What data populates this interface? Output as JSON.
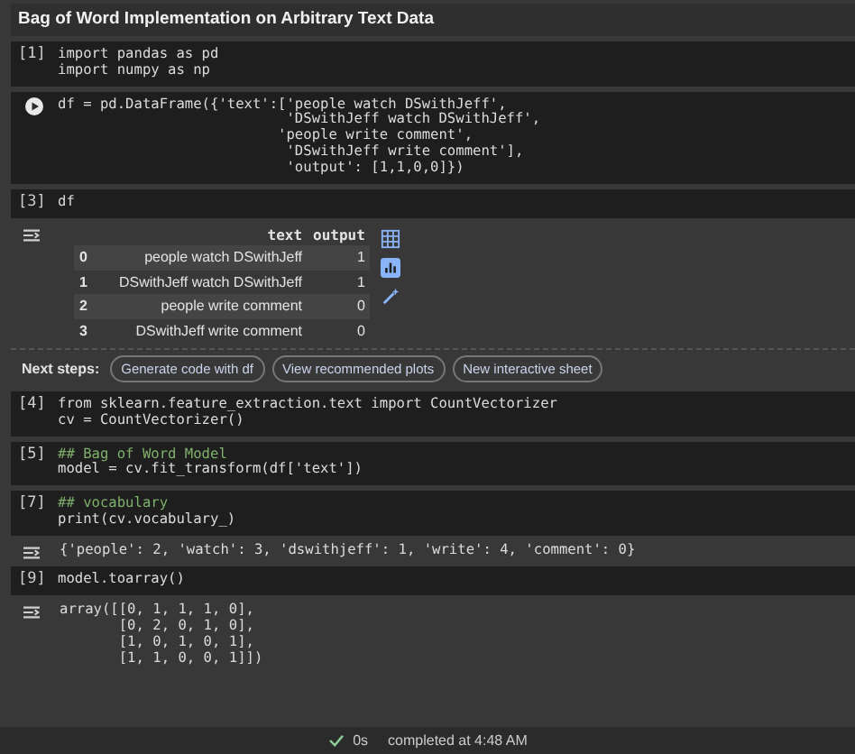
{
  "title": "Bag of Word Implementation on Arbitrary Text Data",
  "cells": [
    {
      "prompt": "[1]",
      "run_button": false,
      "lines": [
        {
          "text": "import pandas as pd",
          "comment": false
        },
        {
          "text": "import numpy as np",
          "comment": false
        }
      ]
    },
    {
      "run_button": true,
      "lines": [
        {
          "text": "df = pd.DataFrame({'text':['people watch DSwithJeff',",
          "comment": false
        },
        {
          "text": "                           'DSwithJeff watch DSwithJeff',",
          "comment": false
        },
        {
          "text": "                          'people write comment',",
          "comment": false
        },
        {
          "text": "                           'DSwithJeff write comment'],",
          "comment": false
        },
        {
          "text": "                           'output': [1,1,0,0]})",
          "comment": false
        }
      ]
    },
    {
      "prompt": "[3]",
      "run_button": false,
      "lines": [
        {
          "text": "df",
          "comment": false
        }
      ],
      "output": {
        "kind": "table",
        "columns": [
          "",
          "text",
          "output"
        ],
        "rows": [
          [
            "0",
            "people watch DSwithJeff",
            "1"
          ],
          [
            "1",
            "DSwithJeff watch DSwithJeff",
            "1"
          ],
          [
            "2",
            "people write comment",
            "0"
          ],
          [
            "3",
            "DSwithJeff write comment",
            "0"
          ]
        ],
        "next_steps": {
          "label": "Next steps:",
          "buttons": [
            "Generate code with df",
            "View recommended plots",
            "New interactive sheet"
          ]
        }
      }
    },
    {
      "prompt": "[4]",
      "run_button": false,
      "lines": [
        {
          "text": "from sklearn.feature_extraction.text import CountVectorizer",
          "comment": false
        },
        {
          "text": "cv = CountVectorizer()",
          "comment": false
        }
      ]
    },
    {
      "prompt": "[5]",
      "run_button": false,
      "lines": [
        {
          "text": "## Bag of Word Model",
          "comment": true
        },
        {
          "text": "model = cv.fit_transform(df['text'])",
          "comment": false
        }
      ]
    },
    {
      "prompt": "[7]",
      "run_button": false,
      "lines": [
        {
          "text": "## vocabulary",
          "comment": true
        },
        {
          "text": "print(cv.vocabulary_)",
          "comment": false
        }
      ],
      "output": {
        "kind": "text",
        "lines": [
          "{'people': 2, 'watch': 3, 'dswithjeff': 1, 'write': 4, 'comment': 0}"
        ]
      }
    },
    {
      "prompt": "[9]",
      "run_button": false,
      "lines": [
        {
          "text": "model.toarray()",
          "comment": false
        }
      ],
      "output": {
        "kind": "text",
        "lines": [
          "array([[0, 1, 1, 1, 0],",
          "       [0, 2, 0, 1, 0],",
          "       [1, 0, 1, 0, 1],",
          "       [1, 1, 0, 0, 1]])"
        ]
      }
    }
  ],
  "status": {
    "duration": "0s",
    "text": "completed at 4:48 AM"
  }
}
